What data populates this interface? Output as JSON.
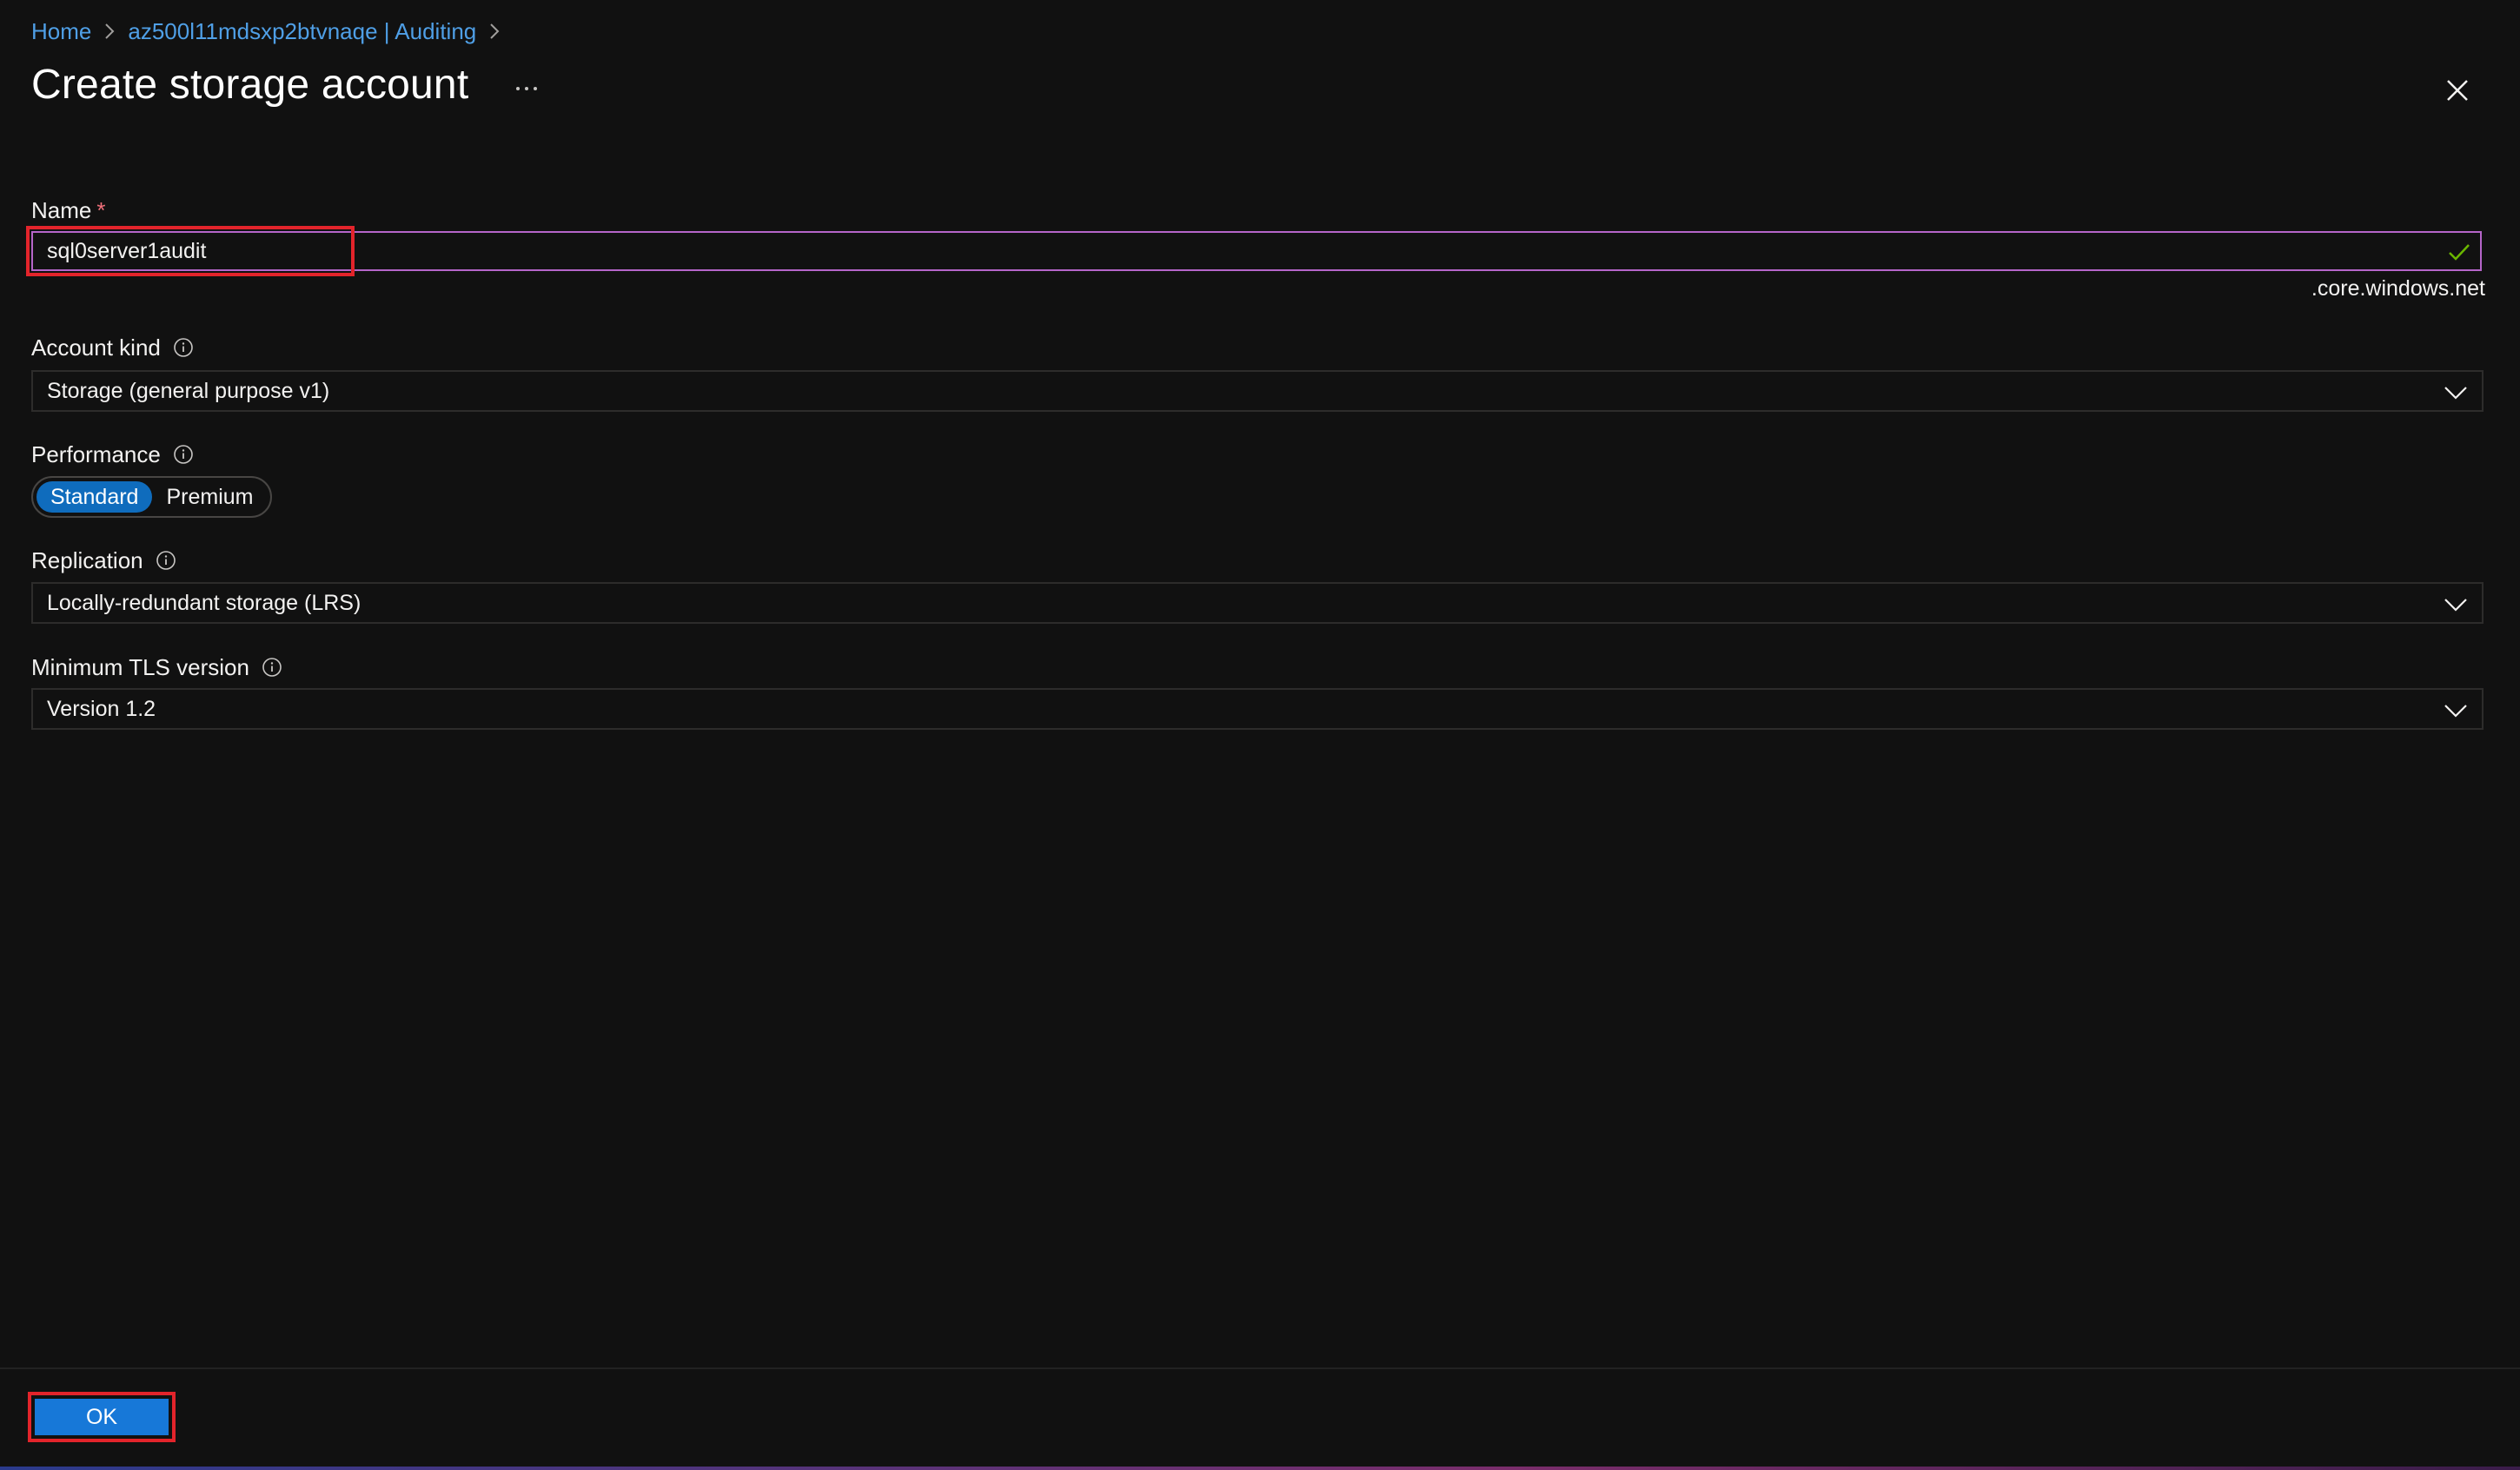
{
  "breadcrumb": {
    "items": [
      {
        "label": "Home"
      },
      {
        "label": "az500l11mdsxp2btvnaqe | Auditing"
      }
    ]
  },
  "page": {
    "title": "Create storage account"
  },
  "fields": {
    "name": {
      "label": "Name",
      "required_marker": "*",
      "value": "sql0server1audit",
      "suffix": ".core.windows.net"
    },
    "account_kind": {
      "label": "Account kind",
      "value": "Storage (general purpose v1)"
    },
    "performance": {
      "label": "Performance",
      "options": [
        "Standard",
        "Premium"
      ],
      "selected": "Standard"
    },
    "replication": {
      "label": "Replication",
      "value": "Locally-redundant storage (LRS)"
    },
    "tls": {
      "label": "Minimum TLS version",
      "value": "Version 1.2"
    }
  },
  "footer": {
    "ok_label": "OK"
  },
  "colors": {
    "background": "#111111",
    "link": "#4f9fe6",
    "accent_primary": "#1778d8",
    "input_focus_border": "#b565c9",
    "highlight_annotation": "#e3242b",
    "valid_check": "#6bb700",
    "required_star": "#f1707b"
  },
  "icons": [
    "chevron-right-icon",
    "more-icon",
    "close-icon",
    "check-icon",
    "info-icon",
    "chevron-down-icon"
  ]
}
